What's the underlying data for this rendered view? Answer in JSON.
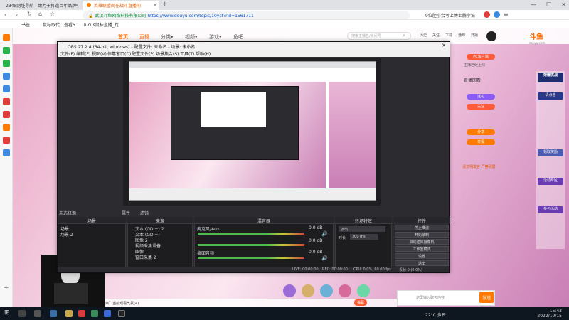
{
  "browser": {
    "tabs": [
      {
        "label": "2345网址导航 - 致力于打造百年品牌",
        "active": false
      },
      {
        "label": "英雄联盟尚在战斗直播间",
        "active": true
      }
    ],
    "new_tab": "+",
    "url_site": "武汉斗鱼网络科技有限公司",
    "url_path": "https://www.douyu.com/topic/10yct?rid=1561711",
    "bookmarks": [
      "书签",
      "鼠标取代、查看5",
      "lucus鼠标直播_找"
    ],
    "right_note": "9位胆小会考上博士腾李诚",
    "window_controls": [
      "—",
      "☐",
      "✕"
    ]
  },
  "site": {
    "nav": [
      "首页",
      "直播",
      "分类▾",
      "视频▾",
      "游戏▾",
      "鱼吧"
    ],
    "search_placeholder": "搜索主播名/房间号",
    "logo": "斗鱼",
    "logo_sub": "douyu.com",
    "header_icons": [
      "历史",
      "关注",
      "下载",
      "通知",
      "开播"
    ]
  },
  "obs": {
    "title": "OBS 27.2.4 (64-bit, windows) - 配置文件: 未命名 - 场景: 未命名",
    "menu": [
      "文件(F)",
      "编辑(E)",
      "视图(V)",
      "停靠窗口(D)",
      "配置文件(P)",
      "场景集合(S)",
      "工具(T)",
      "帮助(H)"
    ],
    "no_source": "未选择源",
    "props_btn": "属性",
    "filters_btn": "滤镜",
    "docks": {
      "scenes": "场景",
      "sources": "来源",
      "mixer": "混音器",
      "transitions": "转场特效",
      "controls": "控件"
    },
    "scenes": [
      "场景",
      "场景 2"
    ],
    "sources": [
      "文本 (GDI+) 2",
      "文本 (GDI+)",
      "图像 2",
      "视频采集设备",
      "图像",
      "窗口采集 2"
    ],
    "mixer": [
      {
        "name": "麦克风/Aux",
        "db": "0.0 dB"
      },
      {
        "name": "",
        "db": "0.0 dB"
      },
      {
        "name": "桌面音频",
        "db": "0.0 dB"
      }
    ],
    "transition": "淡出",
    "duration_label": "时长",
    "duration": "300 ms",
    "controls": [
      "停止推流",
      "开始录制",
      "启动虚拟摄像机",
      "工作室模式",
      "设置",
      "退出"
    ],
    "status": {
      "live": "LIVE: 00:00:00",
      "rec": "REC: 00:00:00",
      "cpu": "CPU: 0.0%, 60.00 fps",
      "drop": "丢帧 0 (0.0%)"
    }
  },
  "right_panel": {
    "pc_btn": "PC客户端",
    "live_hint": "主播已经上线",
    "items": [
      "直播回看",
      "送礼",
      "关注",
      "分享",
      "举报"
    ],
    "warning": "请文明发言 严禁刷屏"
  },
  "chat": {
    "placeholder": "这里输入聊天内容",
    "send": "发送",
    "mode": "弹幕",
    "bottom_text": "【1条】当前观看气氛(4)"
  },
  "side_widget": {
    "title": "荣耀挑战",
    "items": [
      "请点击",
      "领取奖励",
      "活动专区",
      "参与活动"
    ]
  },
  "taskbar": {
    "weather": "22°C 多云",
    "time": "15:43",
    "date": "2022/10/15"
  },
  "colors": {
    "accent": "#ff7a00",
    "douyu_orange": "#ff6a00",
    "obs_bg": "#2b2b30"
  }
}
